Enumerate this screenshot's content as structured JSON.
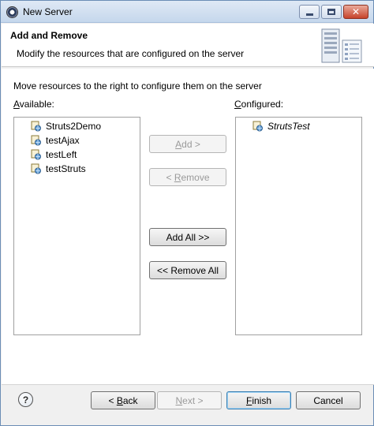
{
  "window": {
    "title": "New Server"
  },
  "banner": {
    "title": "Add and Remove",
    "description": "Modify the resources that are configured on the server"
  },
  "content": {
    "instruction": "Move resources to the right to configure them on the server",
    "available_label": {
      "mnemonic": "A",
      "rest": "vailable:"
    },
    "configured_label": {
      "mnemonic": "C",
      "rest": "onfigured:"
    },
    "available_items": [
      "Struts2Demo",
      "testAjax",
      "testLeft",
      "testStruts"
    ],
    "configured_items": [
      "StrutsTest"
    ]
  },
  "actions": {
    "add": {
      "pre": "",
      "mnemonic": "A",
      "post": "dd >"
    },
    "remove": {
      "pre": "< ",
      "mnemonic": "R",
      "post": "emove"
    },
    "add_all": "Add All >>",
    "remove_all": "<< Remove All"
  },
  "footer": {
    "help": "?",
    "back": {
      "pre": "< ",
      "mnemonic": "B",
      "post": "ack"
    },
    "next": {
      "pre": "",
      "mnemonic": "N",
      "post": "ext >"
    },
    "finish": {
      "pre": "",
      "mnemonic": "F",
      "post": "inish"
    },
    "cancel": "Cancel"
  },
  "colors": {
    "accent_border": "#3c7fb1",
    "title_gradient_top": "#dfe9f5",
    "close_button": "#c7432b"
  }
}
